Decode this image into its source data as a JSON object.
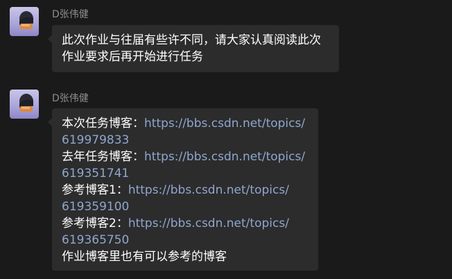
{
  "messages": [
    {
      "sender": "D张伟健",
      "lines": [
        "此次作业与往届有些许不同，请大家认真阅读此次",
        "作业要求后再开始进行任务"
      ]
    },
    {
      "sender": "D张伟健",
      "items": [
        {
          "label": "本次任务博客：",
          "link_part1": "https://bbs.csdn.net/topics/",
          "link_part2": "619979833"
        },
        {
          "label": "去年任务博客：",
          "link_part1": "https://bbs.csdn.net/topics/",
          "link_part2": "619351741"
        },
        {
          "label": "参考博客1：",
          "link_part1": "https://bbs.csdn.net/topics/",
          "link_part2": "619359100"
        },
        {
          "label": "参考博客2：",
          "link_part1": "https://bbs.csdn.net/topics/",
          "link_part2": "619365750"
        }
      ],
      "footer": "作业博客里也有可以参考的博客"
    }
  ],
  "colors": {
    "background": "#1a1a1a",
    "bubble": "#2c2c2c",
    "sender_text": "#8e8e8e",
    "link": "#8ea7cf"
  }
}
